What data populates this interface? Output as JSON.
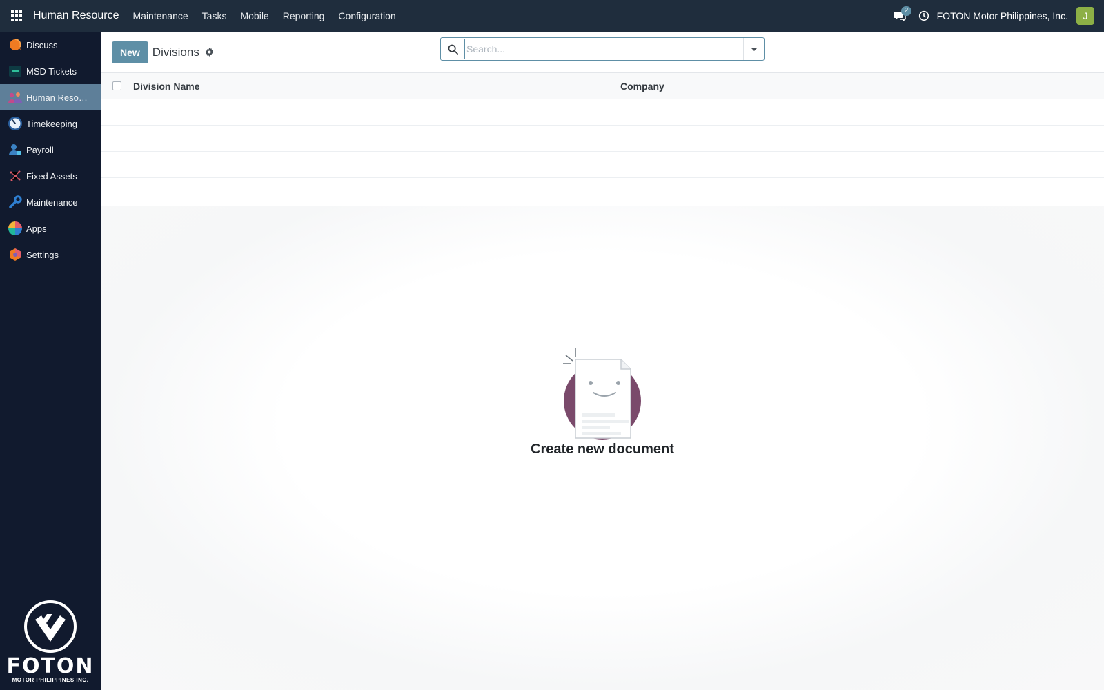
{
  "topbar": {
    "brand": "Human Resource",
    "menu": [
      "Maintenance",
      "Tasks",
      "Mobile",
      "Reporting",
      "Configuration"
    ],
    "chat_count": "2",
    "company": "FOTON Motor Philippines, Inc.",
    "avatar_initial": "J",
    "accent": "#1f2d3d"
  },
  "sidebar": {
    "items": [
      {
        "label": "Discuss",
        "icon": "discuss-icon"
      },
      {
        "label": "MSD Tickets",
        "icon": "msd-tickets-icon"
      },
      {
        "label": "Human Resource",
        "icon": "human-resource-icon",
        "active": true
      },
      {
        "label": "Timekeeping",
        "icon": "timekeeping-icon"
      },
      {
        "label": "Payroll",
        "icon": "payroll-icon"
      },
      {
        "label": "Fixed Assets",
        "icon": "fixed-assets-icon"
      },
      {
        "label": "Maintenance",
        "icon": "maintenance-icon"
      },
      {
        "label": "Apps",
        "icon": "apps-icon"
      },
      {
        "label": "Settings",
        "icon": "settings-icon"
      }
    ],
    "logo_word": "FOTON",
    "logo_sub": "MOTOR PHILIPPINES INC."
  },
  "control": {
    "new_label": "New",
    "title": "Divisions",
    "search_placeholder": "Search..."
  },
  "list": {
    "columns": [
      "Division Name",
      "Company"
    ]
  },
  "empty": {
    "title": "Create new document"
  }
}
